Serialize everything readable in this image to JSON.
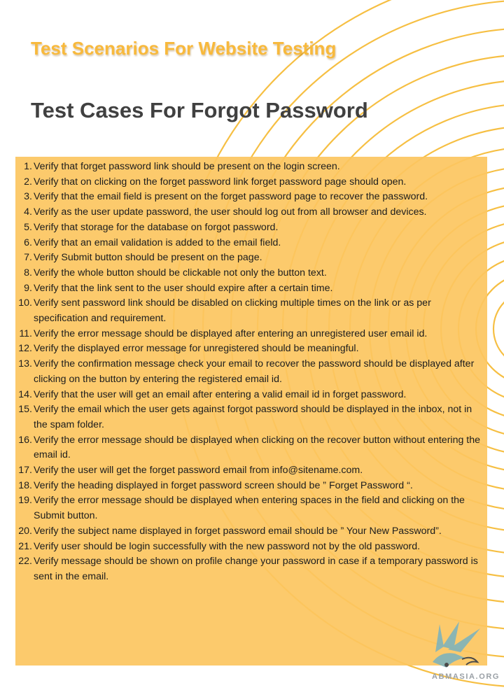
{
  "header": {
    "kicker": "Test Scenarios For Website Testing",
    "title": "Test Cases For Forgot Password"
  },
  "test_cases": [
    {
      "num": "1.",
      "text": "Verify that forget password link should be present on the login screen."
    },
    {
      "num": "2.",
      "text": "Verify that on clicking on the forget password link forget password page should open."
    },
    {
      "num": "3.",
      "text": "Verify that the email field is present on the forget password page to recover the password."
    },
    {
      "num": "4.",
      "text": "Verify as the user update password, the user should log out from all browser and devices."
    },
    {
      "num": "5.",
      "text": "Verify that storage for the database on forgot password."
    },
    {
      "num": "6.",
      "text": "Verify that an email validation is added to the email field."
    },
    {
      "num": "7.",
      "text": "Verify Submit button should be present on the page."
    },
    {
      "num": "8.",
      "text": "Verify the whole button should be clickable not only the button text."
    },
    {
      "num": "9.",
      "text": "Verify that the link sent to the user should expire after a certain time."
    },
    {
      "num": "10.",
      "text": "Verify sent password link should be disabled on clicking multiple times on the link or as per specification and requirement."
    },
    {
      "num": "11.",
      "text": "Verify the error message should be displayed after entering an unregistered user email id."
    },
    {
      "num": "12.",
      "text": "Verify the displayed error message for unregistered should be meaningful."
    },
    {
      "num": "13.",
      "text": "Verify the confirmation message check your email to recover the password should be displayed after clicking on the button by entering the registered email id."
    },
    {
      "num": "14.",
      "text": "Verify that the user will get an email after entering a valid email id in forget password."
    },
    {
      "num": "15.",
      "text": "Verify the email which the user gets against forgot password should be displayed in the inbox, not in the spam folder."
    },
    {
      "num": "16.",
      "text": "Verify the error message should be displayed when clicking on the recover button without entering the email id."
    },
    {
      "num": "17.",
      "text": "Verify the user will get the forget password email from info@sitename.com."
    },
    {
      "num": "18.",
      "text": "Verify the heading displayed in forget password screen should be ” Forget Password “."
    },
    {
      "num": "19.",
      "text": "Verify the error message should be displayed when entering spaces in the field and clicking on the Submit button."
    },
    {
      "num": "20.",
      "text": "Verify the subject name displayed in forget password email should be ” Your New Password”."
    },
    {
      "num": "21.",
      "text": "Verify user should be login successfully with the new password not by the old password."
    },
    {
      "num": "22.",
      "text": "Verify message should be shown on profile change your password in case if a temporary password is sent in the email."
    }
  ],
  "watermark": {
    "text": "ABMASIA.ORG",
    "icon": "bird-logo-icon"
  },
  "colors": {
    "accent": "#f8b93c",
    "panel": "#fcc660",
    "heading": "#404040",
    "arc": "#f6b92f"
  }
}
